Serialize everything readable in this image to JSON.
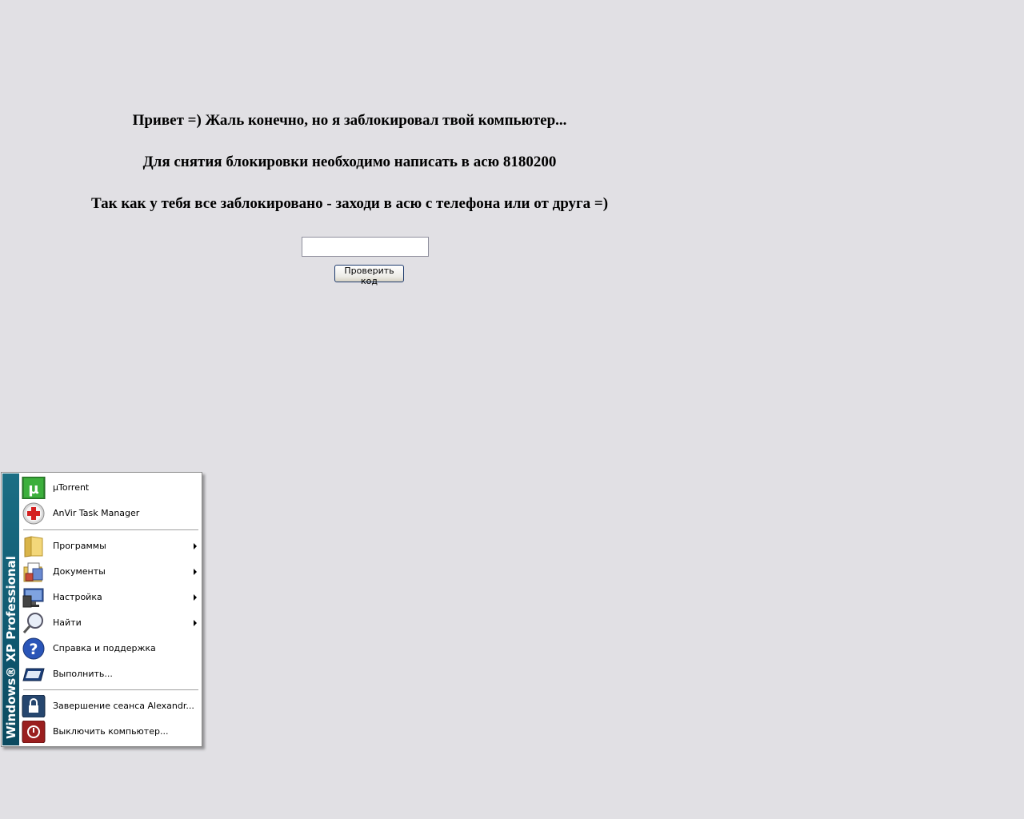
{
  "message": {
    "line1": "Привет =) Жаль конечно, но я заблокировал твой компьютер...",
    "line2": "Для снятия блокировки необходимо написать в асю 8180200",
    "line3": "Так как у тебя все заблокировано - заходи в асю с телефона или от друга =)"
  },
  "form": {
    "code_value": "",
    "check_button_label": "Проверить код"
  },
  "start_menu": {
    "band_text": "Windows® XP Professional",
    "items": [
      {
        "label": "µTorrent",
        "icon": "utorrent-icon",
        "submenu": false
      },
      {
        "label": "AnVir Task Manager",
        "icon": "anvir-icon",
        "submenu": false
      },
      {
        "label": "Программы",
        "icon": "folder-icon",
        "submenu": true
      },
      {
        "label": "Документы",
        "icon": "documents-icon",
        "submenu": true
      },
      {
        "label": "Настройка",
        "icon": "settings-icon",
        "submenu": true
      },
      {
        "label": "Найти",
        "icon": "search-icon",
        "submenu": true
      },
      {
        "label": "Справка и поддержка",
        "icon": "help-icon",
        "submenu": false
      },
      {
        "label": "Выполнить...",
        "icon": "run-icon",
        "submenu": false
      },
      {
        "label": "Завершение сеанса Alexandr...",
        "icon": "logoff-icon",
        "submenu": false
      },
      {
        "label": "Выключить компьютер...",
        "icon": "shutdown-icon",
        "submenu": false
      }
    ]
  },
  "colors": {
    "background": "#e1e0e4",
    "menu_band": "#0f5870"
  }
}
